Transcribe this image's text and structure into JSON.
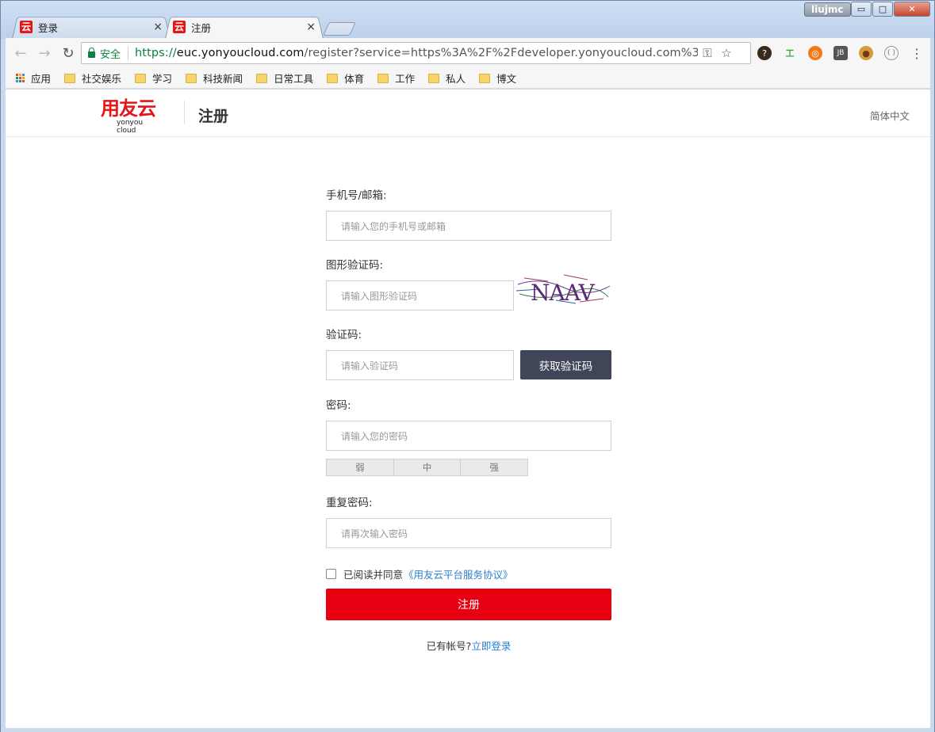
{
  "window": {
    "user_badge": "liujmc",
    "controls": {
      "minimize": "▭",
      "maximize": "□",
      "close": "✕"
    }
  },
  "tabs": [
    {
      "favicon": "云",
      "title": "登录",
      "close": "×",
      "active": false
    },
    {
      "favicon": "云",
      "title": "注册",
      "close": "×",
      "active": true
    }
  ],
  "toolbar": {
    "back": "←",
    "forward": "→",
    "reload": "↻",
    "secure_label": "安全",
    "url_scheme": "https://",
    "url_host": "euc.yonyoucloud.com",
    "url_rest": "/register?service=https%3A%2F%2Fdeveloper.yonyoucloud.com%3A443%2...",
    "key_icon": "⚿",
    "star_icon": "☆",
    "menu_icon": "⋮"
  },
  "bookmarks": {
    "apps_label": "应用",
    "items": [
      "社交娱乐",
      "学习",
      "科技新闻",
      "日常工具",
      "体育",
      "工作",
      "私人",
      "博文"
    ]
  },
  "header": {
    "logo_cn": "用友云",
    "logo_en": "yonyou cloud",
    "title": "注册",
    "language": "简体中文"
  },
  "form": {
    "phone_label": "手机号/邮箱:",
    "phone_placeholder": "请输入您的手机号或邮箱",
    "captcha_label": "图形验证码:",
    "captcha_placeholder": "请输入图形验证码",
    "captcha_text": "NAAV",
    "code_label": "验证码:",
    "code_placeholder": "请输入验证码",
    "get_code_button": "获取验证码",
    "password_label": "密码:",
    "password_placeholder": "请输入您的密码",
    "strength": [
      "弱",
      "中",
      "强"
    ],
    "repeat_label": "重复密码:",
    "repeat_placeholder": "请再次输入密码",
    "agree_text": "已阅读并同意",
    "agreement_link": "《用友云平台服务协议》",
    "submit_button": "注册",
    "have_account": "已有帐号?",
    "login_link": "立即登录"
  }
}
